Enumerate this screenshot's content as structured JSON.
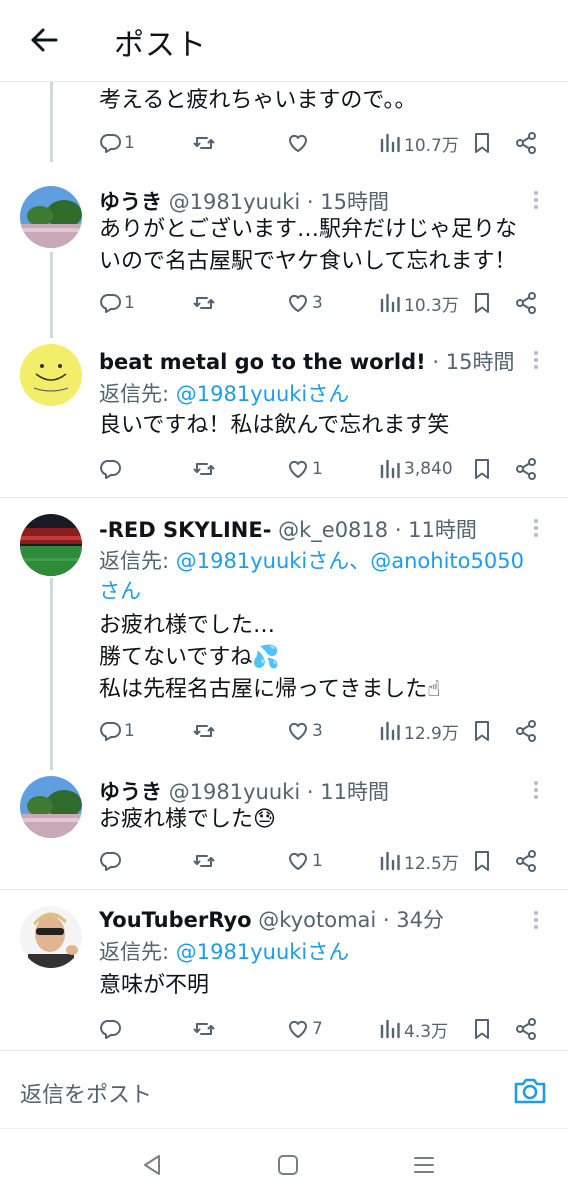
{
  "header": {
    "title": "ポスト"
  },
  "tweets": [
    {
      "text_lines": [
        "考えると疲れちゃいますので。。"
      ],
      "stats": {
        "replies": "1",
        "retweets": "",
        "likes": "",
        "views": "10.7万"
      }
    },
    {
      "name": "ゆうき",
      "handle": "@1981yuuki",
      "time": "· 15時間",
      "text_lines": [
        "ありがとございます…駅弁だけじゃ足りな",
        "いので名古屋駅でヤケ食いして忘れます！"
      ],
      "stats": {
        "replies": "1",
        "retweets": "",
        "likes": "3",
        "views": "10.3万"
      }
    },
    {
      "name": "beat metal go to the world!",
      "handle": "",
      "time": "· 15時間",
      "reply_to_prefix": "返信先: ",
      "reply_to_link": "@1981yuukiさん",
      "text_lines": [
        "良いですね！私は飲んで忘れます笑"
      ],
      "stats": {
        "replies": "",
        "retweets": "",
        "likes": "1",
        "views": "3,840"
      }
    },
    {
      "name": "-RED SKYLINE-",
      "handle": "@k_e0818",
      "time": "· 11時間",
      "reply_to_prefix": "返信先: ",
      "reply_to_link": "@1981yuukiさん、@anohito5050",
      "reply_to_link_2": "さん",
      "text_lines": [
        "お疲れ様でした…",
        "勝てないですね💦",
        "私は先程名古屋に帰ってきました☝"
      ],
      "stats": {
        "replies": "1",
        "retweets": "",
        "likes": "3",
        "views": "12.9万"
      }
    },
    {
      "name": "ゆうき",
      "handle": "@1981yuuki",
      "time": "· 11時間",
      "text_lines": [
        "お疲れ様でした😓"
      ],
      "stats": {
        "replies": "",
        "retweets": "",
        "likes": "1",
        "views": "12.5万"
      }
    },
    {
      "name": "YouTuberRyo",
      "handle": "@kyotomai",
      "time": "· 34分",
      "reply_to_prefix": "返信先: ",
      "reply_to_link": "@1981yuukiさん",
      "text_lines": [
        "意味が不明"
      ],
      "stats": {
        "replies": "",
        "retweets": "",
        "likes": "7",
        "views": "4.3万"
      }
    }
  ],
  "reply_bar": {
    "placeholder": "返信をポスト"
  },
  "icons": {
    "back": "arrow-left-icon",
    "reply": "speech-bubble-icon",
    "retweet": "retweet-icon",
    "like": "heart-icon",
    "views": "bar-chart-icon",
    "bookmark": "bookmark-icon",
    "share": "share-icon",
    "more": "more-vertical-icon",
    "camera": "camera-icon",
    "nav_back": "triangle-back-icon",
    "nav_home": "square-home-icon",
    "nav_recents": "lines-recents-icon"
  },
  "colors": {
    "link": "#1d9bf0",
    "secondary_text": "#536471",
    "thread_line": "#cfd9de"
  }
}
